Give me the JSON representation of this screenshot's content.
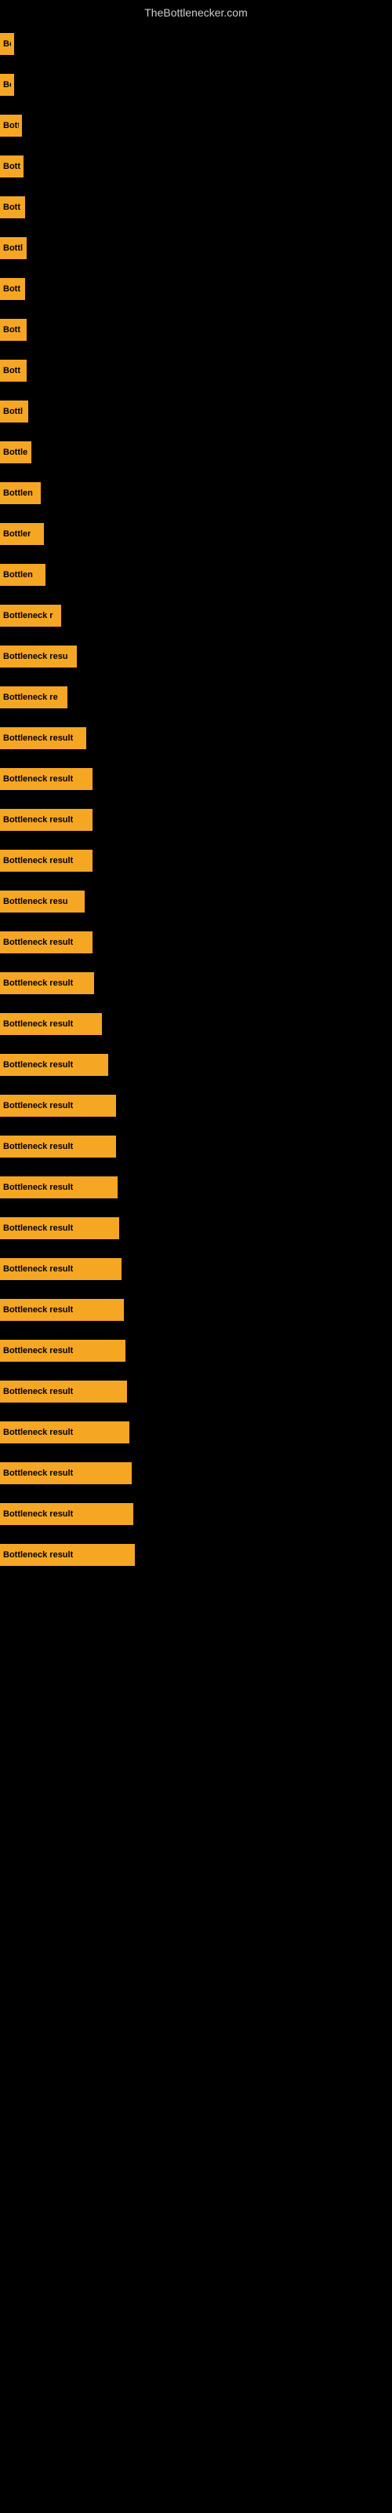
{
  "site_title": "TheBottlenecker.com",
  "bars": [
    {
      "label": "Bo",
      "width": 18
    },
    {
      "label": "Bo",
      "width": 18
    },
    {
      "label": "Bott",
      "width": 28
    },
    {
      "label": "Bott",
      "width": 30
    },
    {
      "label": "Bott",
      "width": 32
    },
    {
      "label": "Bottl",
      "width": 34
    },
    {
      "label": "Bott",
      "width": 32
    },
    {
      "label": "Bott",
      "width": 34
    },
    {
      "label": "Bott",
      "width": 34
    },
    {
      "label": "Bottl",
      "width": 36
    },
    {
      "label": "Bottle",
      "width": 40
    },
    {
      "label": "Bottlen",
      "width": 52
    },
    {
      "label": "Bottler",
      "width": 56
    },
    {
      "label": "Bottlen",
      "width": 58
    },
    {
      "label": "Bottleneck r",
      "width": 78
    },
    {
      "label": "Bottleneck resu",
      "width": 98
    },
    {
      "label": "Bottleneck re",
      "width": 86
    },
    {
      "label": "Bottleneck result",
      "width": 110
    },
    {
      "label": "Bottleneck result",
      "width": 118
    },
    {
      "label": "Bottleneck result",
      "width": 118
    },
    {
      "label": "Bottleneck result",
      "width": 118
    },
    {
      "label": "Bottleneck resu",
      "width": 108
    },
    {
      "label": "Bottleneck result",
      "width": 118
    },
    {
      "label": "Bottleneck result",
      "width": 120
    },
    {
      "label": "Bottleneck result",
      "width": 130
    },
    {
      "label": "Bottleneck result",
      "width": 138
    },
    {
      "label": "Bottleneck result",
      "width": 148
    },
    {
      "label": "Bottleneck result",
      "width": 148
    },
    {
      "label": "Bottleneck result",
      "width": 150
    },
    {
      "label": "Bottleneck result",
      "width": 152
    },
    {
      "label": "Bottleneck result",
      "width": 155
    },
    {
      "label": "Bottleneck result",
      "width": 158
    },
    {
      "label": "Bottleneck result",
      "width": 160
    },
    {
      "label": "Bottleneck result",
      "width": 162
    },
    {
      "label": "Bottleneck result",
      "width": 165
    },
    {
      "label": "Bottleneck result",
      "width": 168
    },
    {
      "label": "Bottleneck result",
      "width": 170
    },
    {
      "label": "Bottleneck result",
      "width": 172
    }
  ]
}
